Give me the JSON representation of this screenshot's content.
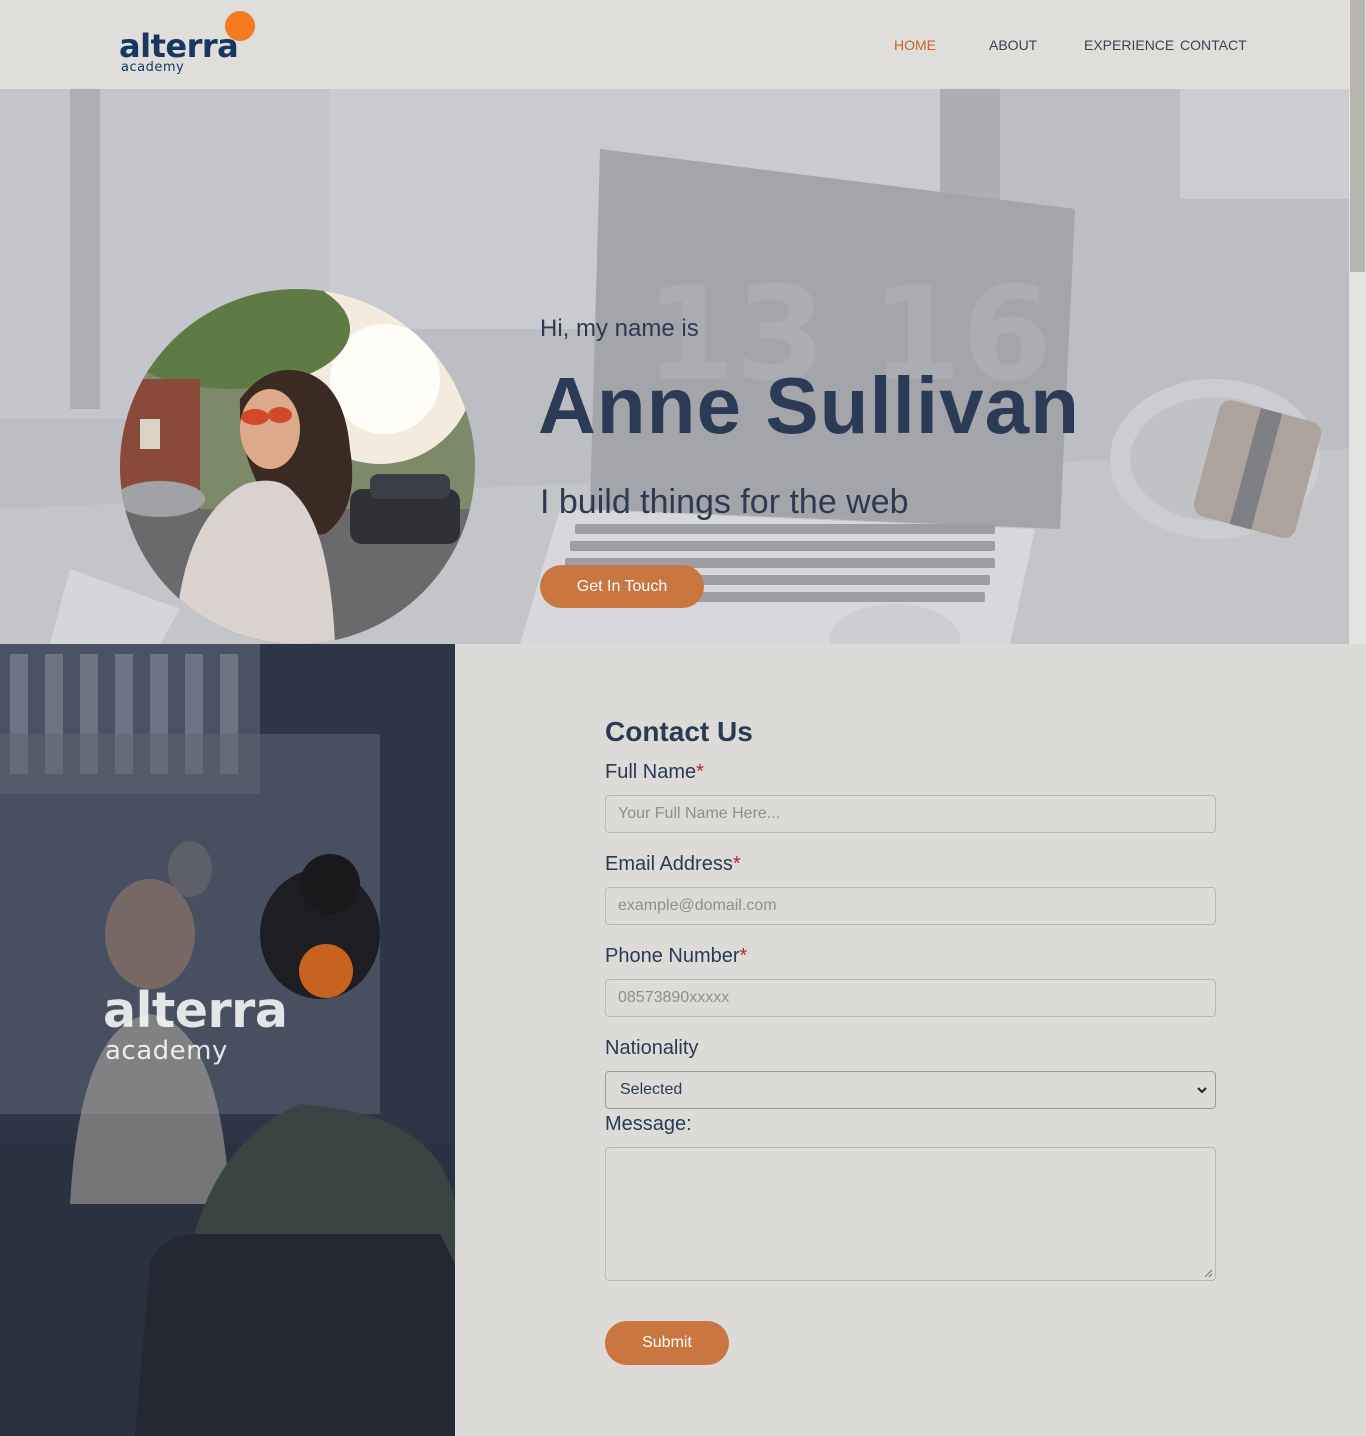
{
  "header": {
    "logo_word": "alterra",
    "logo_sub": "academy",
    "nav": [
      {
        "label": "HOME",
        "active": true
      },
      {
        "label": "ABOUT",
        "active": false
      },
      {
        "label": "EXPERIENCE",
        "active": false
      },
      {
        "label": "CONTACT",
        "active": false
      }
    ]
  },
  "hero": {
    "greeting": "Hi, my name is",
    "name": "Anne Sullivan",
    "tagline": "I build things for the web",
    "cta_label": "Get In Touch",
    "clock_digits": "13 16"
  },
  "side": {
    "logo_word": "alterra",
    "logo_sub": "academy"
  },
  "contact": {
    "title": "Contact Us",
    "full_name": {
      "label": "Full Name",
      "required": "*",
      "placeholder": "Your Full Name Here..."
    },
    "email": {
      "label": "Email Address",
      "required": "*",
      "placeholder": "example@domail.com"
    },
    "phone": {
      "label": "Phone Number",
      "required": "*",
      "placeholder": "08573890xxxxx"
    },
    "nationality": {
      "label": "Nationality",
      "selected": "Selected"
    },
    "message": {
      "label": "Message:"
    },
    "submit_label": "Submit"
  },
  "colors": {
    "accent": "#c97640",
    "logo_orange": "#f47b20",
    "navy": "#2c3b55",
    "required": "#b3262c",
    "background": "#dcdbd8"
  }
}
